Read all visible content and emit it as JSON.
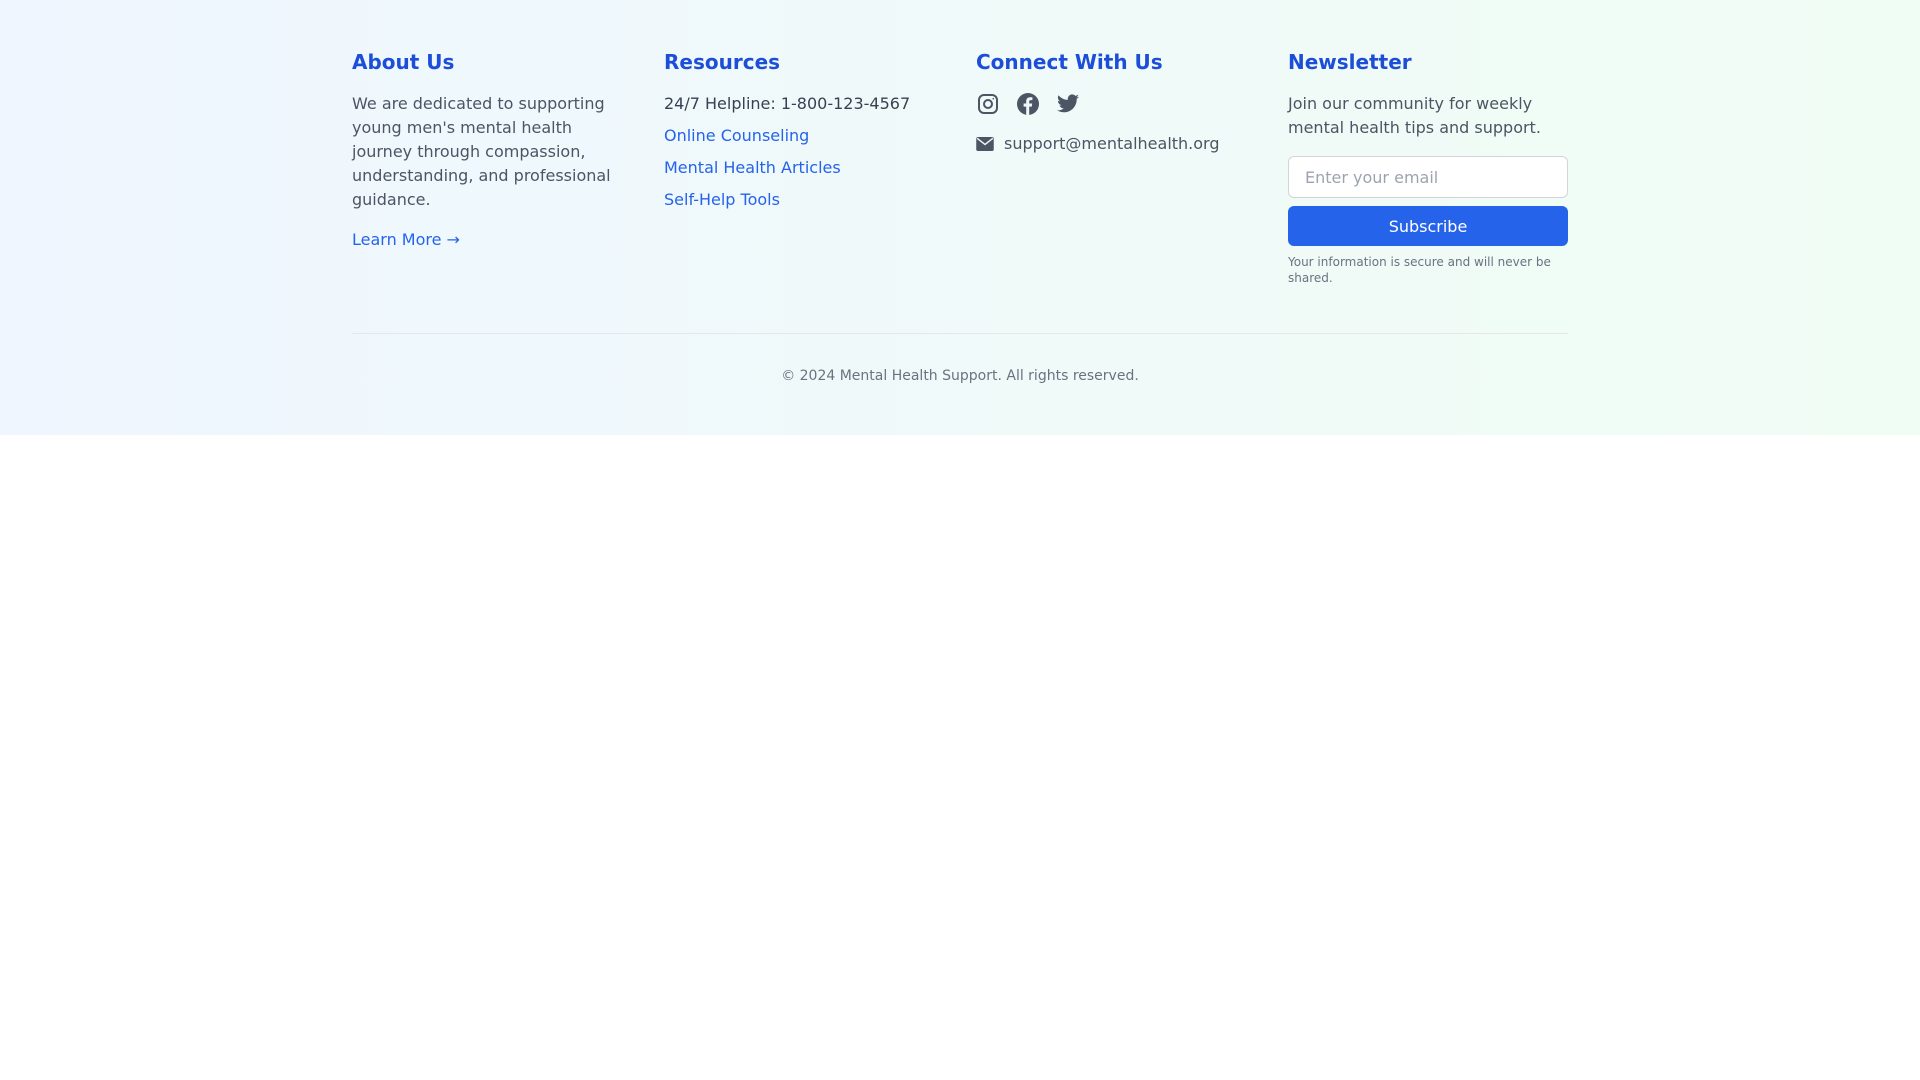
{
  "about": {
    "heading": "About Us",
    "description": "We are dedicated to supporting young men's mental health journey through compassion, understanding, and professional guidance.",
    "learn_more": "Learn More →"
  },
  "resources": {
    "heading": "Resources",
    "helpline": "24/7 Helpline: 1-800-123-4567",
    "links": [
      "Online Counseling",
      "Mental Health Articles",
      "Self-Help Tools"
    ]
  },
  "connect": {
    "heading": "Connect With Us",
    "social_icons": [
      "instagram-icon",
      "facebook-icon",
      "twitter-icon"
    ],
    "email_icon": "envelope-icon",
    "email": "support@mentalhealth.org"
  },
  "newsletter": {
    "heading": "Newsletter",
    "description": "Join our community for weekly mental health tips and support.",
    "email_value": "",
    "email_placeholder": "Enter your email",
    "subscribe_label": "Subscribe",
    "note": "Your information is secure and will never be shared."
  },
  "footer": {
    "copyright": "© 2024 Mental Health Support. All rights reserved."
  },
  "colors": {
    "accent": "#1d4ed8",
    "link": "#2563eb",
    "button": "#2563eb",
    "icon": "#4b5563"
  }
}
